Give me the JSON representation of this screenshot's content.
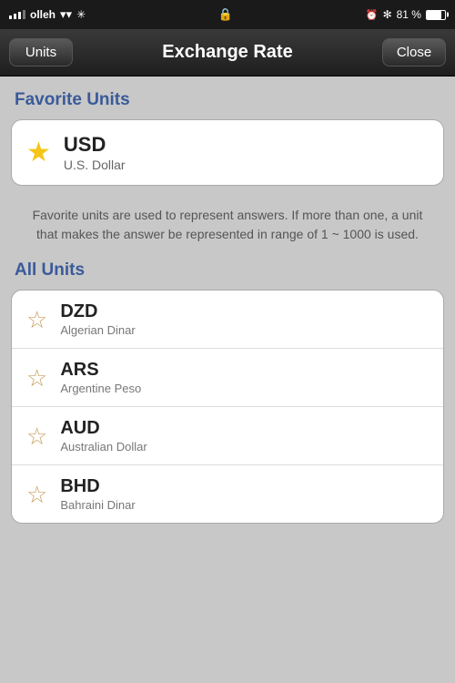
{
  "statusBar": {
    "carrier": "olleh",
    "time": "🕐",
    "battery_percent": "81 %"
  },
  "navBar": {
    "leftButton": "Units",
    "title": "Exchange Rate",
    "rightButton": "Close"
  },
  "favoriteSection": {
    "header": "Favorite Units",
    "item": {
      "code": "USD",
      "name": "U.S. Dollar"
    },
    "infoText": "Favorite units are used to represent answers. If more than one, a unit that makes the answer be represented in range of 1 ~ 1000 is used."
  },
  "allUnitsSection": {
    "header": "All Units",
    "items": [
      {
        "code": "DZD",
        "name": "Algerian Dinar"
      },
      {
        "code": "ARS",
        "name": "Argentine Peso"
      },
      {
        "code": "AUD",
        "name": "Australian Dollar"
      },
      {
        "code": "BHD",
        "name": "Bahraini Dinar"
      }
    ]
  }
}
